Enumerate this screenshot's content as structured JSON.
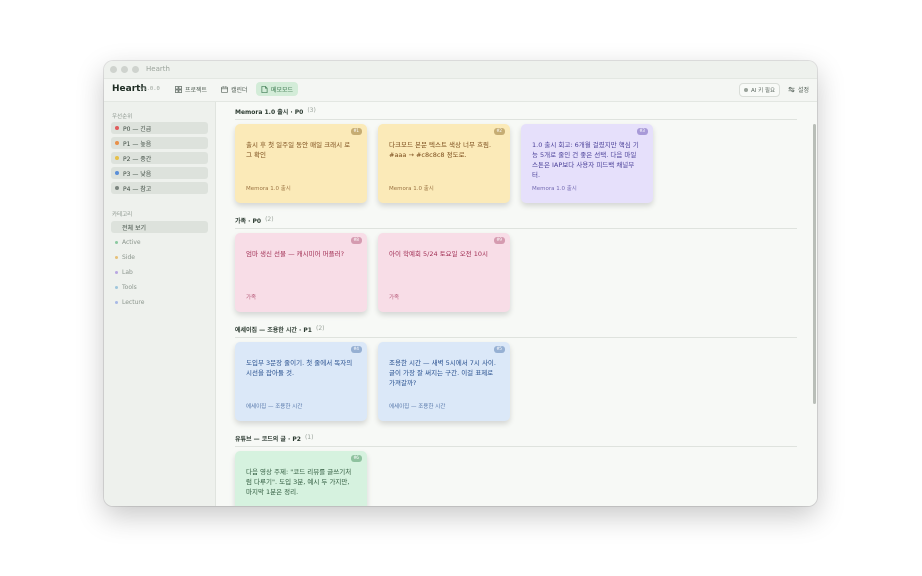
{
  "window": {
    "title": "Hearth"
  },
  "toolbar": {
    "brand": "Hearth",
    "version": "v1.0.0",
    "nav": [
      {
        "label": "프로젝트",
        "icon": "grid-icon"
      },
      {
        "label": "캘린더",
        "icon": "calendar-icon"
      },
      {
        "label": "메모모드",
        "icon": "note-icon",
        "active": true
      }
    ],
    "ai_label": "AI 키 필요",
    "settings_label": "설정"
  },
  "sidebar": {
    "priority_heading": "우선순위",
    "priorities": [
      {
        "label": "P0 — 긴급",
        "color": "#e05d5d"
      },
      {
        "label": "P1 — 높음",
        "color": "#e8904a"
      },
      {
        "label": "P2 — 중간",
        "color": "#e6c04a"
      },
      {
        "label": "P3 — 낮음",
        "color": "#5a8fd8"
      },
      {
        "label": "P4 — 참고",
        "color": "#7c8680"
      }
    ],
    "category_heading": "카테고리",
    "all_label": "전체 보기",
    "categories": [
      {
        "label": "Active",
        "color": "#8cc9a0"
      },
      {
        "label": "Side",
        "color": "#e6c078"
      },
      {
        "label": "Lab",
        "color": "#b9a8e2"
      },
      {
        "label": "Tools",
        "color": "#9fc6dc"
      },
      {
        "label": "Lecture",
        "color": "#a9b9e6"
      }
    ]
  },
  "sections": [
    {
      "title": "Memora 1.0 출시 · P0",
      "count": "(3)",
      "cards": [
        {
          "id": "#1",
          "text": "출시 후 첫 일주일 동안 매일 크래시 로그 확인",
          "footer": "Memora 1.0 출시",
          "color": "yellow"
        },
        {
          "id": "#2",
          "text": "다크모드 본문 텍스트 색상 너무 흐림. #aaa → #c8c8c8 정도로.",
          "footer": "Memora 1.0 출시",
          "color": "yellow"
        },
        {
          "id": "#3",
          "text": "1.0 출시 회고: 6개월 걸렸지만 핵심 기능 5개로 줄인 건 좋은 선택. 다음 마일스톤은 IAP보다 사용자 피드백 채널부터.",
          "footer": "Memora 1.0 출시",
          "color": "purple"
        }
      ]
    },
    {
      "title": "가족 · P0",
      "count": "(2)",
      "cards": [
        {
          "id": "#8",
          "text": "엄마 생신 선물 — 캐시미어 머플러?",
          "footer": "가족",
          "color": "pink"
        },
        {
          "id": "#9",
          "text": "아이 학예회 5/24 토요일 오전 10시",
          "footer": "가족",
          "color": "pink"
        }
      ]
    },
    {
      "title": "에세이집 — 조용한 시간 · P1",
      "count": "(2)",
      "cards": [
        {
          "id": "#4",
          "text": "도입부 3문장 줄이기. 첫 줄에서 독자의 시선을 잡아둘 것.",
          "footer": "에세이집 — 조용한 시간",
          "color": "blue"
        },
        {
          "id": "#5",
          "text": "조용한 시간 — 새벽 5시에서 7시 사이. 글이 가장 잘 써지는 구간. 이걸 표제로 가져갈까?",
          "footer": "에세이집 — 조용한 시간",
          "color": "blue"
        }
      ]
    },
    {
      "title": "유튜브 — 코드의 글 · P2",
      "count": "(1)",
      "cards": [
        {
          "id": "#6",
          "text": "다음 영상 주제: \"코드 리뷰를 글쓰기처럼 다루기\". 도입 3분, 예시 두 가지만, 마지막 1분은 정리.",
          "footer": "",
          "color": "green"
        }
      ]
    }
  ]
}
